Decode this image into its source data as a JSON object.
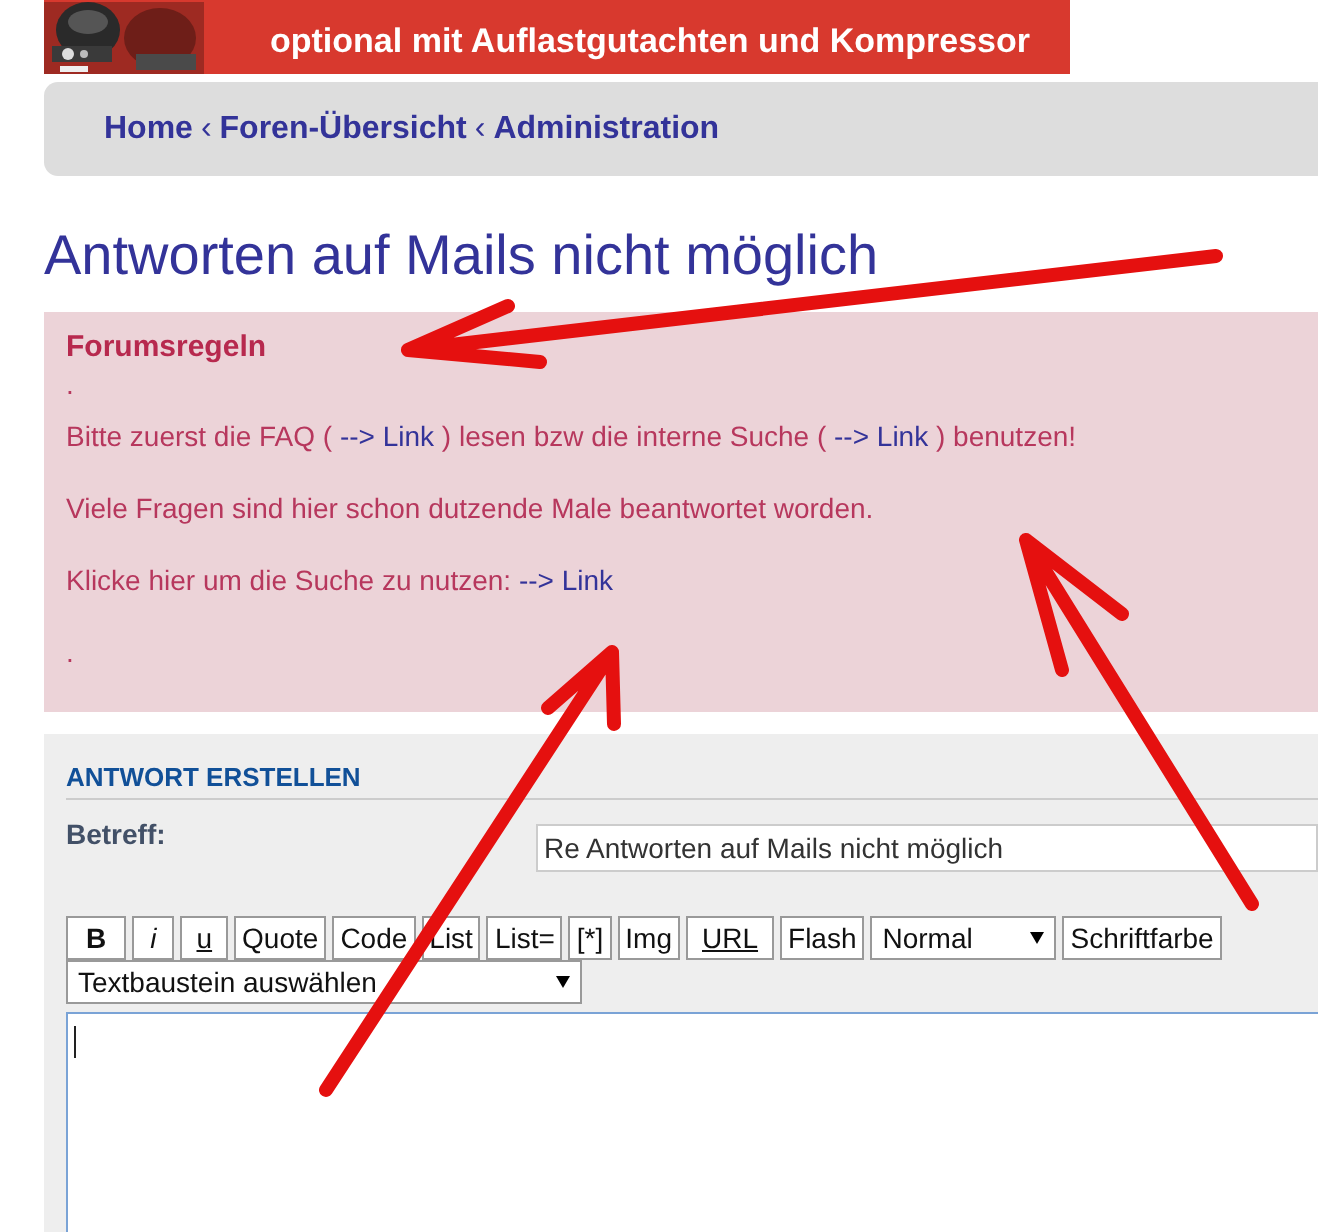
{
  "banner": {
    "text": "optional mit Auflastgutachten und Kompressor"
  },
  "breadcrumbs": [
    {
      "label": "Home"
    },
    {
      "label": "Foren-Übersicht"
    },
    {
      "label": "Administration"
    }
  ],
  "breadcrumb_separator": "‹",
  "title": "Antworten auf Mails nicht möglich",
  "rules": {
    "heading": "Forumsregeln",
    "paragraphs": [
      [
        {
          "text": "."
        }
      ],
      [
        {
          "text": "Bitte zuerst die FAQ ( "
        },
        {
          "text": "--> Link",
          "kind": "link"
        },
        {
          "text": " ) lesen bzw die interne Suche ( "
        },
        {
          "text": "--> Link",
          "kind": "link"
        },
        {
          "text": " ) benutzen!"
        }
      ],
      [
        {
          "text": "Viele Fragen sind hier schon dutzende Male beantwortet worden."
        }
      ],
      [
        {
          "text": "Klicke hier um die Suche zu nutzen: "
        },
        {
          "text": "--> Link",
          "kind": "link"
        }
      ],
      [
        {
          "text": "."
        }
      ]
    ]
  },
  "reply": {
    "heading": "ANTWORT ERSTELLEN",
    "subject_label": "Betreff:",
    "subject_value": "Re Antworten auf Mails nicht möglich",
    "toolbar": [
      {
        "kind": "bold",
        "label": "B"
      },
      {
        "kind": "italic",
        "label": "i"
      },
      {
        "kind": "underline",
        "label": "u"
      },
      {
        "kind": "button",
        "label": "Quote"
      },
      {
        "kind": "button",
        "label": "Code"
      },
      {
        "kind": "button",
        "label": "List"
      },
      {
        "kind": "button",
        "label": "List="
      },
      {
        "kind": "button",
        "label": "[*]"
      },
      {
        "kind": "button",
        "label": "Img"
      },
      {
        "kind": "underline",
        "label": "URL"
      },
      {
        "kind": "button",
        "label": "Flash"
      },
      {
        "kind": "select",
        "label": "Normal"
      },
      {
        "kind": "button",
        "label": "Schriftfarbe"
      },
      {
        "kind": "wide-select",
        "label": "Textbaustein auswählen"
      }
    ]
  }
}
